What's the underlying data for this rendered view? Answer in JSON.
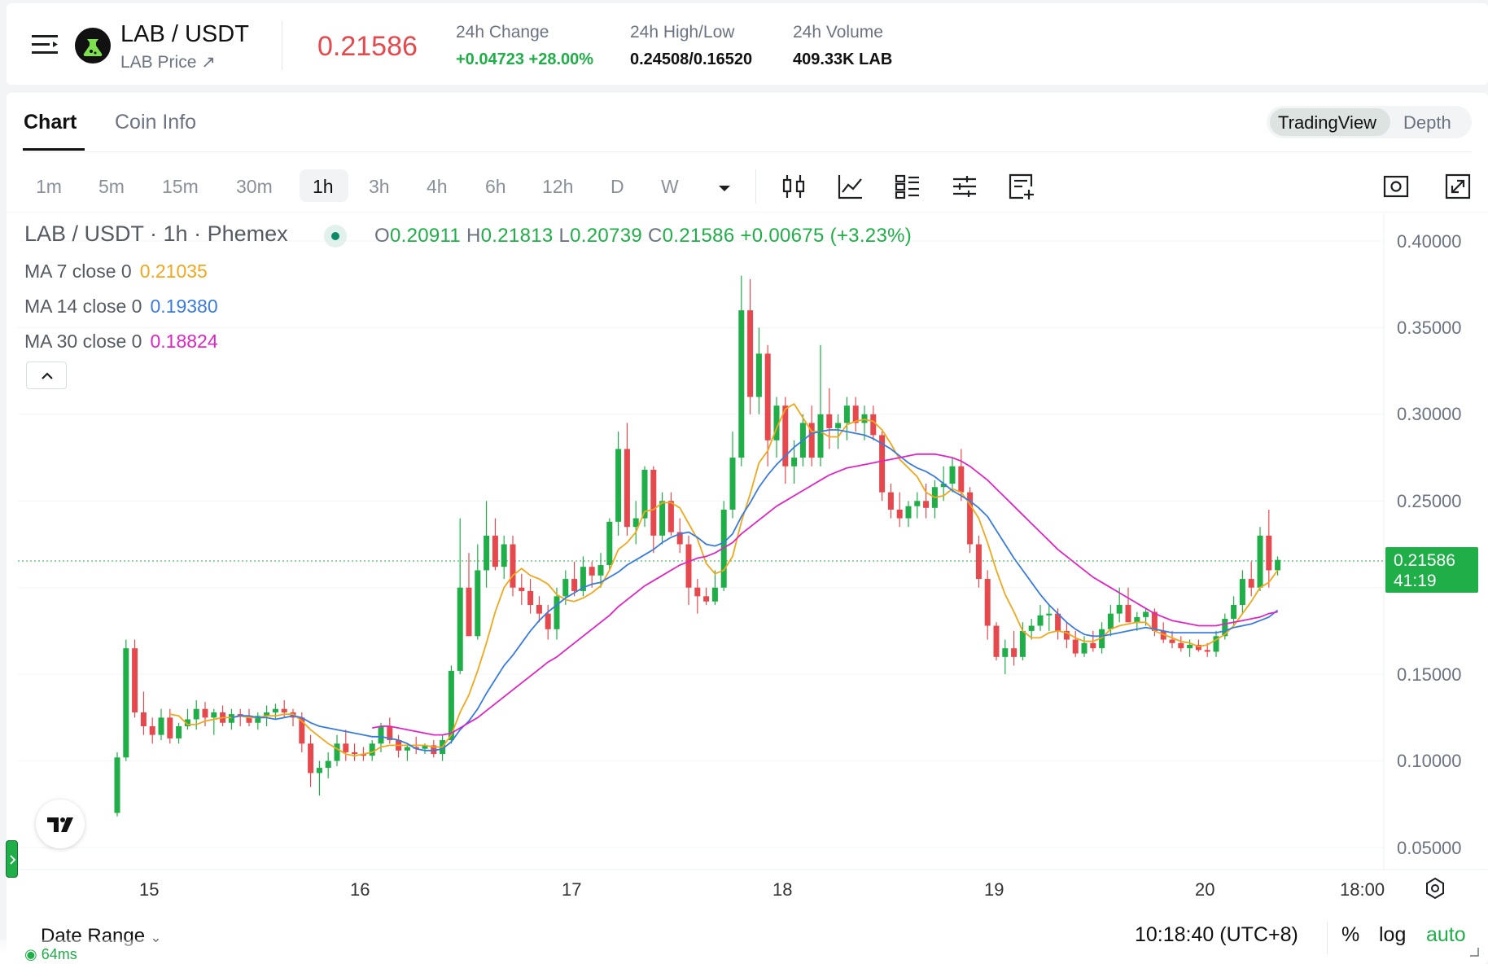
{
  "header": {
    "pair": "LAB / USDT",
    "subtitle": "LAB Price",
    "last_price": "0.21586",
    "stats": [
      {
        "label": "24h Change",
        "value": "+0.04723 +28.00%",
        "positive": true
      },
      {
        "label": "24h High/Low",
        "value": "0.24508/0.16520",
        "positive": false
      },
      {
        "label": "24h Volume",
        "value": "409.33K LAB",
        "positive": false
      }
    ]
  },
  "tabs": [
    {
      "label": "Chart",
      "active": true
    },
    {
      "label": "Coin Info",
      "active": false
    }
  ],
  "view_toggle": [
    {
      "label": "TradingView",
      "active": true
    },
    {
      "label": "Depth",
      "active": false
    }
  ],
  "timeframes": [
    "1m",
    "5m",
    "15m",
    "30m",
    "1h",
    "3h",
    "4h",
    "6h",
    "12h",
    "D",
    "W"
  ],
  "active_timeframe": "1h",
  "tools": [
    "candles-icon",
    "line-chart-icon",
    "indicators-icon",
    "settings-sliders-icon",
    "add-note-icon"
  ],
  "legend": {
    "title": "LAB / USDT · 1h · Phemex",
    "o_key": "O",
    "o_val": "0.20911",
    "h_key": "H",
    "h_val": "0.21813",
    "l_key": "L",
    "l_val": "0.20739",
    "c_key": "C",
    "c_val": "0.21586",
    "change": "+0.00675 (+3.23%)",
    "ma": [
      {
        "label": "MA 7 close 0",
        "value": "0.21035",
        "color": "#f0a71b"
      },
      {
        "label": "MA 14 close 0",
        "value": "0.19380",
        "color": "#3a7be0"
      },
      {
        "label": "MA 30 close 0",
        "value": "0.18824",
        "color": "#e024c4"
      }
    ]
  },
  "price_tag": {
    "price": "0.21586",
    "countdown": "41:19"
  },
  "axis": {
    "y_ticks": [
      "0.40000",
      "0.35000",
      "0.30000",
      "0.25000",
      "0.15000",
      "0.10000",
      "0.05000"
    ],
    "x_ticks": [
      "15",
      "16",
      "17",
      "18",
      "19",
      "20",
      "18:00"
    ]
  },
  "footer": {
    "date_range": "Date Range",
    "latency": "64ms",
    "clock": "10:18:40 (UTC+8)",
    "percent": "%",
    "log": "log",
    "auto": "auto"
  },
  "colors": {
    "up": "#1fae48",
    "down": "#e5484d",
    "accent": "#1fae48"
  },
  "chart_data": {
    "type": "candlestick",
    "ylim": [
      0.03,
      0.41
    ],
    "candles": [
      [
        0.07,
        0.105,
        0.068,
        0.102
      ],
      [
        0.102,
        0.17,
        0.1,
        0.165
      ],
      [
        0.165,
        0.17,
        0.125,
        0.128
      ],
      [
        0.128,
        0.14,
        0.115,
        0.12
      ],
      [
        0.12,
        0.125,
        0.11,
        0.115
      ],
      [
        0.115,
        0.13,
        0.112,
        0.125
      ],
      [
        0.125,
        0.13,
        0.11,
        0.113
      ],
      [
        0.113,
        0.122,
        0.11,
        0.12
      ],
      [
        0.12,
        0.13,
        0.118,
        0.124
      ],
      [
        0.124,
        0.135,
        0.118,
        0.13
      ],
      [
        0.13,
        0.134,
        0.12,
        0.125
      ],
      [
        0.125,
        0.13,
        0.115,
        0.128
      ],
      [
        0.128,
        0.132,
        0.12,
        0.122
      ],
      [
        0.122,
        0.13,
        0.118,
        0.127
      ],
      [
        0.127,
        0.13,
        0.12,
        0.126
      ],
      [
        0.126,
        0.13,
        0.12,
        0.122
      ],
      [
        0.122,
        0.128,
        0.118,
        0.126
      ],
      [
        0.126,
        0.132,
        0.12,
        0.128
      ],
      [
        0.128,
        0.133,
        0.124,
        0.13
      ],
      [
        0.13,
        0.135,
        0.125,
        0.128
      ],
      [
        0.128,
        0.13,
        0.12,
        0.125
      ],
      [
        0.125,
        0.128,
        0.105,
        0.11
      ],
      [
        0.11,
        0.115,
        0.085,
        0.093
      ],
      [
        0.093,
        0.1,
        0.08,
        0.096
      ],
      [
        0.096,
        0.105,
        0.09,
        0.1
      ],
      [
        0.1,
        0.115,
        0.097,
        0.11
      ],
      [
        0.11,
        0.118,
        0.1,
        0.105
      ],
      [
        0.105,
        0.11,
        0.1,
        0.104
      ],
      [
        0.104,
        0.108,
        0.1,
        0.103
      ],
      [
        0.103,
        0.112,
        0.1,
        0.11
      ],
      [
        0.11,
        0.122,
        0.105,
        0.12
      ],
      [
        0.12,
        0.125,
        0.11,
        0.112
      ],
      [
        0.112,
        0.115,
        0.102,
        0.106
      ],
      [
        0.106,
        0.11,
        0.1,
        0.108
      ],
      [
        0.108,
        0.114,
        0.104,
        0.107
      ],
      [
        0.107,
        0.11,
        0.104,
        0.109
      ],
      [
        0.109,
        0.112,
        0.102,
        0.104
      ],
      [
        0.104,
        0.115,
        0.1,
        0.112
      ],
      [
        0.112,
        0.155,
        0.11,
        0.152
      ],
      [
        0.152,
        0.24,
        0.15,
        0.2
      ],
      [
        0.2,
        0.22,
        0.18,
        0.172
      ],
      [
        0.172,
        0.225,
        0.17,
        0.21
      ],
      [
        0.21,
        0.25,
        0.2,
        0.23
      ],
      [
        0.23,
        0.24,
        0.21,
        0.212
      ],
      [
        0.212,
        0.23,
        0.205,
        0.225
      ],
      [
        0.225,
        0.23,
        0.195,
        0.2
      ],
      [
        0.2,
        0.208,
        0.19,
        0.198
      ],
      [
        0.198,
        0.205,
        0.185,
        0.19
      ],
      [
        0.19,
        0.195,
        0.18,
        0.185
      ],
      [
        0.185,
        0.19,
        0.17,
        0.176
      ],
      [
        0.176,
        0.2,
        0.17,
        0.195
      ],
      [
        0.195,
        0.21,
        0.19,
        0.205
      ],
      [
        0.205,
        0.215,
        0.195,
        0.198
      ],
      [
        0.198,
        0.218,
        0.195,
        0.212
      ],
      [
        0.212,
        0.215,
        0.2,
        0.207
      ],
      [
        0.207,
        0.22,
        0.2,
        0.213
      ],
      [
        0.213,
        0.24,
        0.21,
        0.238
      ],
      [
        0.238,
        0.29,
        0.23,
        0.28
      ],
      [
        0.28,
        0.295,
        0.23,
        0.235
      ],
      [
        0.235,
        0.25,
        0.225,
        0.24
      ],
      [
        0.24,
        0.27,
        0.235,
        0.268
      ],
      [
        0.268,
        0.27,
        0.22,
        0.23
      ],
      [
        0.23,
        0.255,
        0.225,
        0.25
      ],
      [
        0.25,
        0.255,
        0.23,
        0.232
      ],
      [
        0.232,
        0.24,
        0.22,
        0.225
      ],
      [
        0.225,
        0.23,
        0.19,
        0.2
      ],
      [
        0.2,
        0.205,
        0.185,
        0.195
      ],
      [
        0.195,
        0.2,
        0.19,
        0.192
      ],
      [
        0.192,
        0.21,
        0.19,
        0.2
      ],
      [
        0.2,
        0.25,
        0.198,
        0.245
      ],
      [
        0.245,
        0.29,
        0.24,
        0.275
      ],
      [
        0.275,
        0.38,
        0.27,
        0.36
      ],
      [
        0.36,
        0.378,
        0.3,
        0.31
      ],
      [
        0.31,
        0.35,
        0.3,
        0.335
      ],
      [
        0.335,
        0.34,
        0.27,
        0.285
      ],
      [
        0.285,
        0.31,
        0.275,
        0.305
      ],
      [
        0.305,
        0.31,
        0.26,
        0.27
      ],
      [
        0.27,
        0.285,
        0.26,
        0.275
      ],
      [
        0.275,
        0.3,
        0.27,
        0.295
      ],
      [
        0.295,
        0.305,
        0.27,
        0.275
      ],
      [
        0.275,
        0.34,
        0.27,
        0.3
      ],
      [
        0.3,
        0.315,
        0.28,
        0.292
      ],
      [
        0.292,
        0.3,
        0.28,
        0.295
      ],
      [
        0.295,
        0.31,
        0.285,
        0.305
      ],
      [
        0.305,
        0.31,
        0.29,
        0.295
      ],
      [
        0.295,
        0.305,
        0.285,
        0.3
      ],
      [
        0.3,
        0.305,
        0.285,
        0.288
      ],
      [
        0.288,
        0.29,
        0.25,
        0.255
      ],
      [
        0.255,
        0.26,
        0.24,
        0.245
      ],
      [
        0.245,
        0.255,
        0.235,
        0.24
      ],
      [
        0.24,
        0.25,
        0.235,
        0.247
      ],
      [
        0.247,
        0.255,
        0.24,
        0.25
      ],
      [
        0.25,
        0.26,
        0.24,
        0.246
      ],
      [
        0.246,
        0.262,
        0.24,
        0.258
      ],
      [
        0.258,
        0.27,
        0.25,
        0.26
      ],
      [
        0.26,
        0.275,
        0.255,
        0.27
      ],
      [
        0.27,
        0.28,
        0.25,
        0.255
      ],
      [
        0.255,
        0.258,
        0.22,
        0.225
      ],
      [
        0.225,
        0.23,
        0.2,
        0.205
      ],
      [
        0.205,
        0.21,
        0.17,
        0.178
      ],
      [
        0.178,
        0.18,
        0.158,
        0.16
      ],
      [
        0.16,
        0.17,
        0.15,
        0.165
      ],
      [
        0.165,
        0.175,
        0.155,
        0.16
      ],
      [
        0.16,
        0.18,
        0.158,
        0.175
      ],
      [
        0.175,
        0.182,
        0.17,
        0.178
      ],
      [
        0.178,
        0.19,
        0.175,
        0.184
      ],
      [
        0.184,
        0.19,
        0.175,
        0.185
      ],
      [
        0.185,
        0.188,
        0.17,
        0.175
      ],
      [
        0.175,
        0.18,
        0.165,
        0.17
      ],
      [
        0.17,
        0.175,
        0.16,
        0.162
      ],
      [
        0.162,
        0.172,
        0.16,
        0.168
      ],
      [
        0.168,
        0.175,
        0.163,
        0.165
      ],
      [
        0.165,
        0.18,
        0.162,
        0.176
      ],
      [
        0.176,
        0.19,
        0.172,
        0.185
      ],
      [
        0.185,
        0.2,
        0.18,
        0.19
      ],
      [
        0.19,
        0.2,
        0.18,
        0.18
      ],
      [
        0.18,
        0.186,
        0.175,
        0.183
      ],
      [
        0.183,
        0.188,
        0.178,
        0.186
      ],
      [
        0.186,
        0.188,
        0.172,
        0.175
      ],
      [
        0.175,
        0.18,
        0.168,
        0.17
      ],
      [
        0.17,
        0.175,
        0.165,
        0.168
      ],
      [
        0.168,
        0.172,
        0.163,
        0.165
      ],
      [
        0.165,
        0.17,
        0.16,
        0.167
      ],
      [
        0.167,
        0.17,
        0.163,
        0.164
      ],
      [
        0.164,
        0.168,
        0.16,
        0.163
      ],
      [
        0.163,
        0.175,
        0.16,
        0.172
      ],
      [
        0.172,
        0.185,
        0.17,
        0.182
      ],
      [
        0.182,
        0.195,
        0.178,
        0.19
      ],
      [
        0.19,
        0.21,
        0.185,
        0.205
      ],
      [
        0.205,
        0.215,
        0.195,
        0.2
      ],
      [
        0.2,
        0.235,
        0.198,
        0.23
      ],
      [
        0.23,
        0.245,
        0.2,
        0.21
      ],
      [
        0.21,
        0.218,
        0.207,
        0.216
      ]
    ],
    "ma7": [
      null,
      null,
      null,
      null,
      null,
      null,
      0.127,
      0.126,
      0.121,
      0.121,
      0.123,
      0.124,
      0.125,
      0.125,
      0.126,
      0.125,
      0.125,
      0.126,
      0.126,
      0.127,
      0.127,
      0.123,
      0.118,
      0.114,
      0.11,
      0.107,
      0.104,
      0.103,
      0.104,
      0.105,
      0.108,
      0.109,
      0.109,
      0.109,
      0.109,
      0.109,
      0.108,
      0.108,
      0.115,
      0.128,
      0.138,
      0.152,
      0.168,
      0.186,
      0.2,
      0.207,
      0.211,
      0.207,
      0.205,
      0.202,
      0.196,
      0.193,
      0.192,
      0.194,
      0.197,
      0.201,
      0.21,
      0.222,
      0.226,
      0.232,
      0.244,
      0.245,
      0.249,
      0.249,
      0.246,
      0.237,
      0.228,
      0.214,
      0.208,
      0.21,
      0.218,
      0.238,
      0.254,
      0.272,
      0.279,
      0.292,
      0.303,
      0.306,
      0.298,
      0.29,
      0.29,
      0.287,
      0.287,
      0.294,
      0.296,
      0.297,
      0.296,
      0.291,
      0.283,
      0.274,
      0.269,
      0.264,
      0.255,
      0.252,
      0.253,
      0.257,
      0.255,
      0.248,
      0.24,
      0.226,
      0.21,
      0.196,
      0.186,
      0.175,
      0.171,
      0.171,
      0.174,
      0.175,
      0.174,
      0.171,
      0.169,
      0.169,
      0.171,
      0.176,
      0.178,
      0.179,
      0.18,
      0.18,
      0.175,
      0.173,
      0.171,
      0.169,
      0.168,
      0.166,
      0.167,
      0.17,
      0.173,
      0.178,
      0.185,
      0.192,
      0.2,
      0.203,
      0.21
    ],
    "ma14": [
      null,
      null,
      null,
      null,
      null,
      null,
      null,
      null,
      null,
      null,
      null,
      null,
      null,
      0.125,
      0.126,
      0.126,
      0.125,
      0.125,
      0.124,
      0.125,
      0.126,
      0.125,
      0.122,
      0.12,
      0.119,
      0.118,
      0.117,
      0.116,
      0.115,
      0.114,
      0.114,
      0.113,
      0.112,
      0.11,
      0.107,
      0.106,
      0.106,
      0.107,
      0.111,
      0.118,
      0.123,
      0.13,
      0.139,
      0.147,
      0.155,
      0.161,
      0.168,
      0.175,
      0.181,
      0.186,
      0.19,
      0.194,
      0.197,
      0.2,
      0.202,
      0.203,
      0.206,
      0.209,
      0.213,
      0.216,
      0.219,
      0.222,
      0.226,
      0.229,
      0.231,
      0.232,
      0.229,
      0.225,
      0.224,
      0.226,
      0.231,
      0.241,
      0.249,
      0.258,
      0.265,
      0.271,
      0.276,
      0.281,
      0.285,
      0.289,
      0.29,
      0.291,
      0.291,
      0.29,
      0.289,
      0.288,
      0.286,
      0.283,
      0.28,
      0.276,
      0.272,
      0.269,
      0.267,
      0.264,
      0.26,
      0.256,
      0.253,
      0.25,
      0.246,
      0.241,
      0.233,
      0.225,
      0.217,
      0.21,
      0.203,
      0.196,
      0.19,
      0.185,
      0.18,
      0.176,
      0.173,
      0.172,
      0.172,
      0.173,
      0.174,
      0.175,
      0.176,
      0.177,
      0.176,
      0.175,
      0.174,
      0.174,
      0.174,
      0.174,
      0.174,
      0.174,
      0.175,
      0.177,
      0.178,
      0.179,
      0.181,
      0.183,
      0.187
    ],
    "ma30": [
      null,
      null,
      null,
      null,
      null,
      null,
      null,
      null,
      null,
      null,
      null,
      null,
      null,
      null,
      null,
      null,
      null,
      null,
      null,
      null,
      null,
      null,
      null,
      null,
      null,
      null,
      null,
      null,
      null,
      0.119,
      0.12,
      0.12,
      0.119,
      0.118,
      0.117,
      0.116,
      0.115,
      0.115,
      0.116,
      0.119,
      0.122,
      0.125,
      0.129,
      0.133,
      0.137,
      0.141,
      0.145,
      0.149,
      0.153,
      0.157,
      0.16,
      0.164,
      0.168,
      0.172,
      0.176,
      0.18,
      0.184,
      0.189,
      0.193,
      0.197,
      0.201,
      0.204,
      0.207,
      0.21,
      0.213,
      0.215,
      0.217,
      0.218,
      0.22,
      0.223,
      0.226,
      0.231,
      0.235,
      0.239,
      0.243,
      0.247,
      0.25,
      0.253,
      0.256,
      0.259,
      0.262,
      0.265,
      0.267,
      0.269,
      0.27,
      0.271,
      0.272,
      0.273,
      0.274,
      0.275,
      0.276,
      0.277,
      0.277,
      0.277,
      0.276,
      0.275,
      0.273,
      0.27,
      0.266,
      0.262,
      0.257,
      0.252,
      0.247,
      0.242,
      0.237,
      0.232,
      0.227,
      0.222,
      0.218,
      0.214,
      0.21,
      0.206,
      0.203,
      0.2,
      0.197,
      0.194,
      0.191,
      0.188,
      0.185,
      0.183,
      0.181,
      0.18,
      0.179,
      0.178,
      0.178,
      0.178,
      0.179,
      0.18,
      0.181,
      0.182,
      0.183,
      0.185,
      0.186
    ]
  }
}
